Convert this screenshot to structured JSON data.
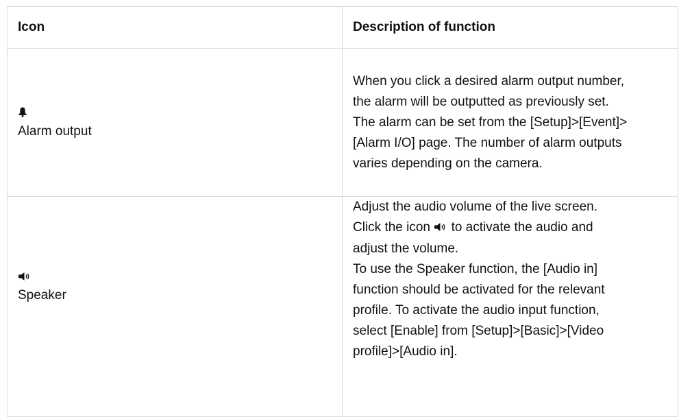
{
  "table": {
    "headers": {
      "icon": "Icon",
      "description": "Description of function"
    },
    "rows": [
      {
        "icon_name": "bell-icon",
        "label": "Alarm output",
        "description_lines": [
          "When you click a desired alarm output number,",
          "the alarm will be outputted as previously set.",
          "The alarm can be set from the [Setup]>[Event]>",
          "[Alarm I/O] page. The number of alarm outputs",
          "varies depending on the camera."
        ]
      },
      {
        "icon_name": "speaker-icon",
        "label": "Speaker",
        "description_lines": {
          "l0": "Adjust the audio volume of the live screen.",
          "l1a": "Click the icon",
          "l1b": "to activate the audio and",
          "l2": "adjust the volume.",
          "l3": "To use the Speaker function, the [Audio in]",
          "l4": "function should be activated for the relevant",
          "l5": "profile. To activate the audio input function,",
          "l6": "select [Enable] from [Setup]>[Basic]>[Video",
          "l7": "profile]>[Audio in]."
        }
      }
    ]
  }
}
